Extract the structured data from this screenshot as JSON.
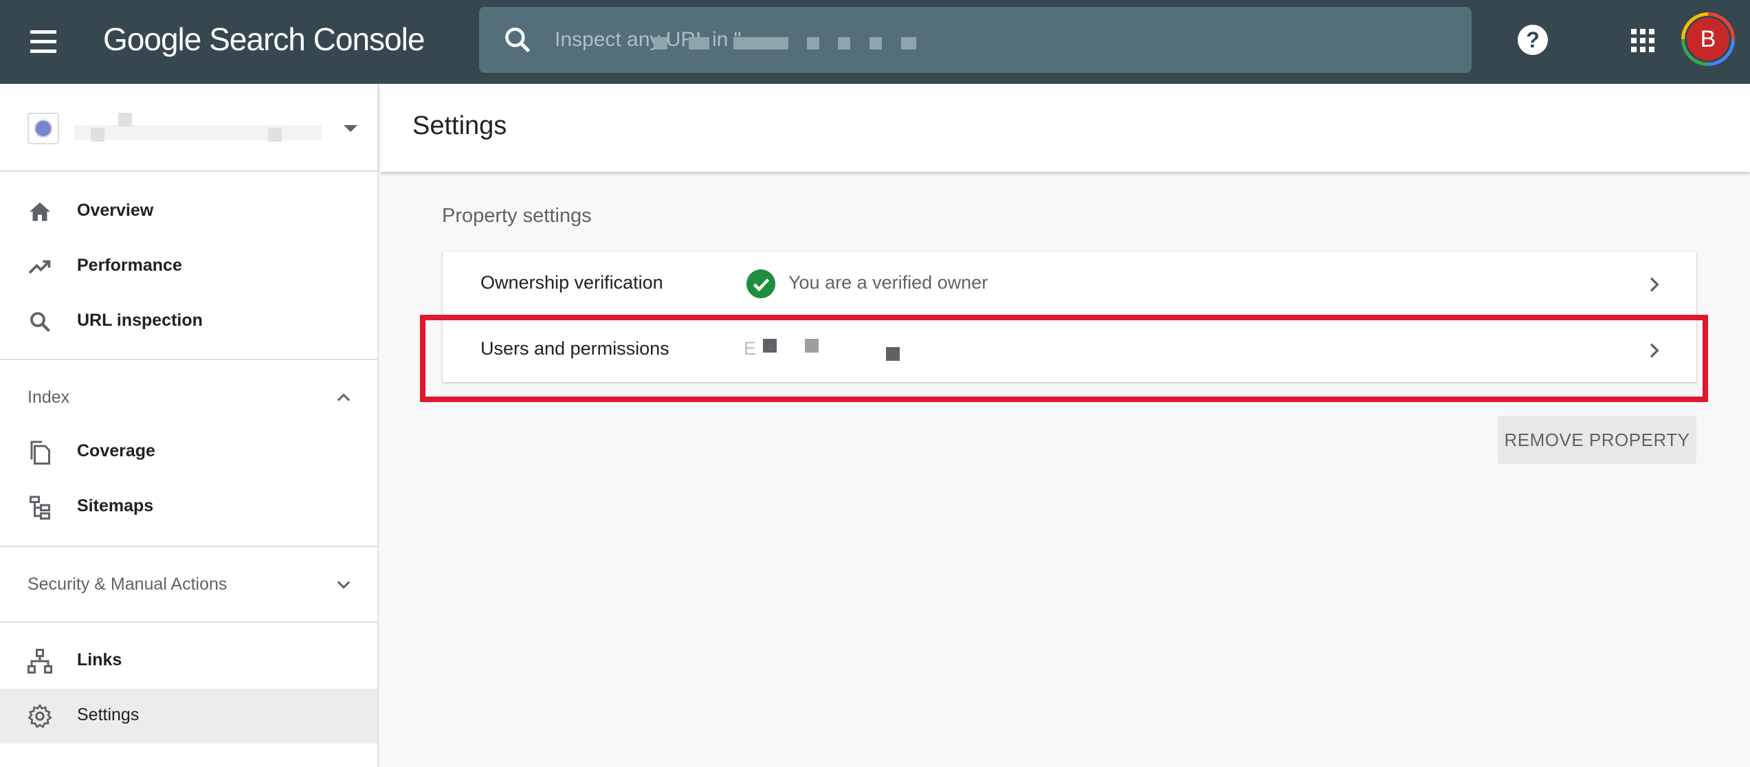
{
  "app": {
    "title_google": "Google",
    "title_rest": "Search Console"
  },
  "search": {
    "placeholder": "Inspect any URL in \""
  },
  "avatar": {
    "initial": "B"
  },
  "sidebar": {
    "items": [
      {
        "label": "Overview",
        "icon": "home-icon"
      },
      {
        "label": "Performance",
        "icon": "trending-up-icon"
      },
      {
        "label": "URL inspection",
        "icon": "search-icon"
      }
    ],
    "index_section": {
      "label": "Index",
      "expanded": true,
      "items": [
        {
          "label": "Coverage",
          "icon": "copy-pages-icon"
        },
        {
          "label": "Sitemaps",
          "icon": "sitemap-icon"
        }
      ]
    },
    "security_section": {
      "label": "Security & Manual Actions",
      "expanded": false
    },
    "bottom_items": [
      {
        "label": "Links",
        "icon": "network-links-icon"
      },
      {
        "label": "Settings",
        "icon": "gear-icon",
        "active": true
      }
    ]
  },
  "main": {
    "title": "Settings",
    "section_title": "Property settings",
    "rows": [
      {
        "label": "Ownership verification",
        "value": "You are a verified owner",
        "status_icon": "check-circle-icon"
      },
      {
        "label": "Users and permissions",
        "value": "E"
      }
    ],
    "remove_button": "REMOVE PROPERTY"
  },
  "colors": {
    "topbar": "#37474f",
    "search_bg": "#546e7a",
    "verified_green": "#1e8e3e",
    "highlight_red": "#e0192e",
    "active_nav": "#ececec"
  }
}
